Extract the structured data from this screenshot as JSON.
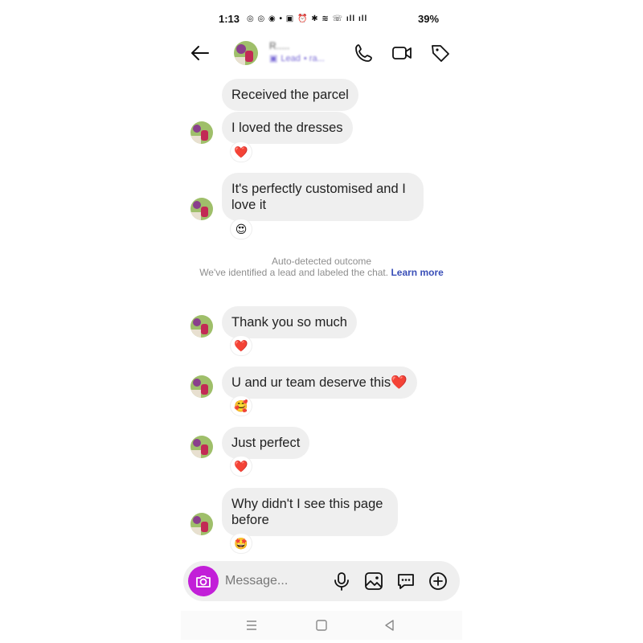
{
  "status": {
    "time": "1:13",
    "icons": "◎ ◎ ◉ • ▣ ⏰ ✱ ≋ ☏ ıll ıll",
    "battery": "39%"
  },
  "header": {
    "name": "R.....",
    "sub_label": "Lead",
    "sub_extra": "• ra..."
  },
  "messages": [
    {
      "text": "Received the parcel",
      "reaction": ""
    },
    {
      "text": "I loved the dresses",
      "reaction": "❤️"
    },
    {
      "text": "It's perfectly customised and I love it",
      "reaction": "😍"
    },
    {
      "text": "Thank you so much",
      "reaction": "❤️"
    },
    {
      "text": "U and ur team deserve this❤️",
      "reaction": "🥰"
    },
    {
      "text": "Just perfect",
      "reaction": "❤️"
    },
    {
      "text": "Why didn't I see this page before",
      "reaction": "🤩"
    }
  ],
  "system_note": {
    "title": "Auto-detected outcome",
    "body": "We've identified a lead and labeled the chat.",
    "link": "Learn more"
  },
  "composer": {
    "placeholder": "Message..."
  },
  "colors": {
    "bubble": "#efefef",
    "camera": "#c21fd8",
    "link": "#3a4fb8"
  }
}
